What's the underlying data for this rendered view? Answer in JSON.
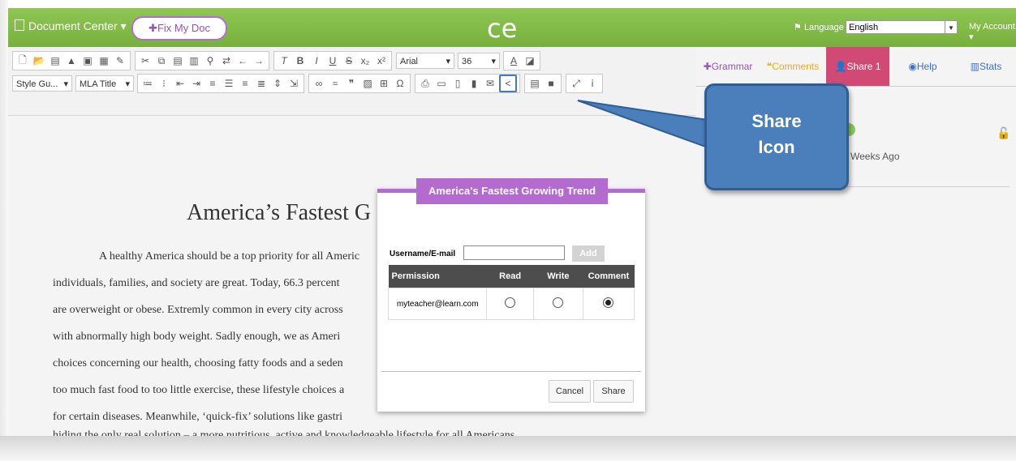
{
  "header": {
    "doc_center": "Document Center",
    "fix_btn": "Fix My Doc",
    "logo": "CE",
    "language_label": "Language",
    "language_value": "English",
    "account": "My Account"
  },
  "toolbar": {
    "font_name": "Arial",
    "font_size": "36",
    "style_select": "Style Gu...",
    "mla_select": "MLA Title"
  },
  "right_panel": {
    "tabs": {
      "grammar": "Grammar",
      "comments": "Comments",
      "share": "Share 1",
      "help": "Help",
      "stats": "Stats"
    },
    "time": "2 Weeks Ago"
  },
  "document": {
    "title": "America’s Fastest G",
    "lines": [
      "A healthy America should be a top priority for all Americ",
      "individuals, families, and society are great.  Today, 66.3 percent",
      "are overweight or obese.  Extremly common in every city across",
      "with abnormally high body weight.  Sadly enough, we as Ameri",
      "choices concerning our health, choosing fatty foods and a seden",
      "too much fast food to too little exercise, these lifestyle choices a",
      "for certain diseases.  Meanwhile, ‘quick-fix’ solutions like gastri",
      "hiding the only real solution – a more nutritious, active and knowledgeable lifestyle for all Americans."
    ]
  },
  "dialog": {
    "title": "America's Fastest Growing Trend",
    "username_label": "Username/E-mail",
    "add_btn": "Add",
    "columns": [
      "Permission",
      "Read",
      "Write",
      "Comment"
    ],
    "rows": [
      {
        "user": "myteacher@learn.com",
        "read": false,
        "write": false,
        "comment": true
      }
    ],
    "cancel_btn": "Cancel",
    "share_btn": "Share"
  },
  "callout": {
    "line1": "Share",
    "line2": "Icon"
  }
}
